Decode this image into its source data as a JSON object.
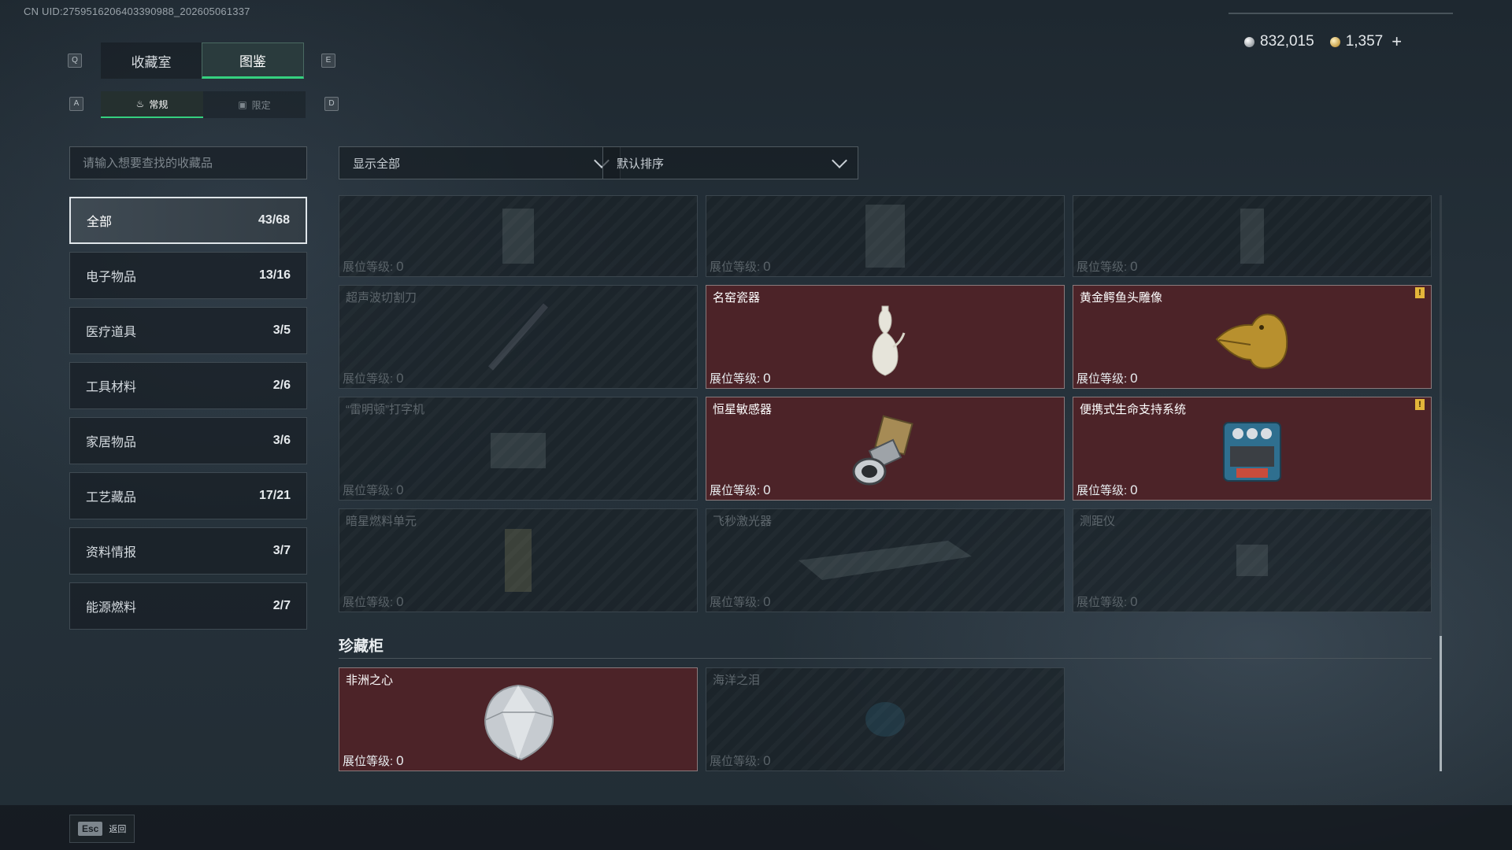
{
  "uid_text": "CN UID:2759516206403390988_202605061337",
  "currency": {
    "silver": "832,015",
    "gold": "1,357",
    "plus": "+"
  },
  "keys": {
    "q": "Q",
    "e": "E",
    "a": "A",
    "d": "D"
  },
  "tabs": [
    {
      "label": "收藏室"
    },
    {
      "label": "图鉴",
      "active": true
    }
  ],
  "subtabs": [
    {
      "label": "常规",
      "active": true
    },
    {
      "label": "限定"
    }
  ],
  "search": {
    "placeholder": "请输入想要查找的收藏品"
  },
  "categories": [
    {
      "label": "全部",
      "count": "43/68",
      "active": true
    },
    {
      "label": "电子物品",
      "count": "13/16"
    },
    {
      "label": "医疗道具",
      "count": "3/5"
    },
    {
      "label": "工具材料",
      "count": "2/6"
    },
    {
      "label": "家居物品",
      "count": "3/6"
    },
    {
      "label": "工艺藏品",
      "count": "17/21"
    },
    {
      "label": "资料情报",
      "count": "3/7"
    },
    {
      "label": "能源燃料",
      "count": "2/7"
    }
  ],
  "filters": {
    "show": "显示全部",
    "sort": "默认排序"
  },
  "level_label": "展位等级:",
  "items": [
    {
      "name": "",
      "level": "0",
      "owned": false
    },
    {
      "name": "",
      "level": "0",
      "owned": false
    },
    {
      "name": "",
      "level": "0",
      "owned": false
    },
    {
      "name": "超声波切割刀",
      "level": "0",
      "owned": false
    },
    {
      "name": "名窑瓷器",
      "level": "0",
      "owned": true
    },
    {
      "name": "黄金鳄鱼头雕像",
      "level": "0",
      "owned": true,
      "alert": "!"
    },
    {
      "name": "“雷明顿”打字机",
      "level": "0",
      "owned": false
    },
    {
      "name": "恒星敏感器",
      "level": "0",
      "owned": true
    },
    {
      "name": "便携式生命支持系统",
      "level": "0",
      "owned": true,
      "alert": "!"
    },
    {
      "name": "暗星燃料单元",
      "level": "0",
      "owned": false
    },
    {
      "name": "飞秒激光器",
      "level": "0",
      "owned": false
    },
    {
      "name": "测距仪",
      "level": "0",
      "owned": false
    }
  ],
  "section": {
    "title": "珍藏柜"
  },
  "treasures": [
    {
      "name": "非洲之心",
      "level": "0",
      "owned": true
    },
    {
      "name": "海洋之泪",
      "level": "0",
      "owned": false
    }
  ],
  "footer": {
    "esc_key": "Esc",
    "back_label": "返回"
  },
  "colors": {
    "accent": "#35d07f",
    "owned_bg": "#4c2328",
    "alert": "#e3b53a"
  },
  "icons": [
    "silver-coin-icon",
    "gold-coin-icon",
    "chevron-down-icon",
    "flame-icon",
    "limited-icon",
    "alert-icon"
  ]
}
